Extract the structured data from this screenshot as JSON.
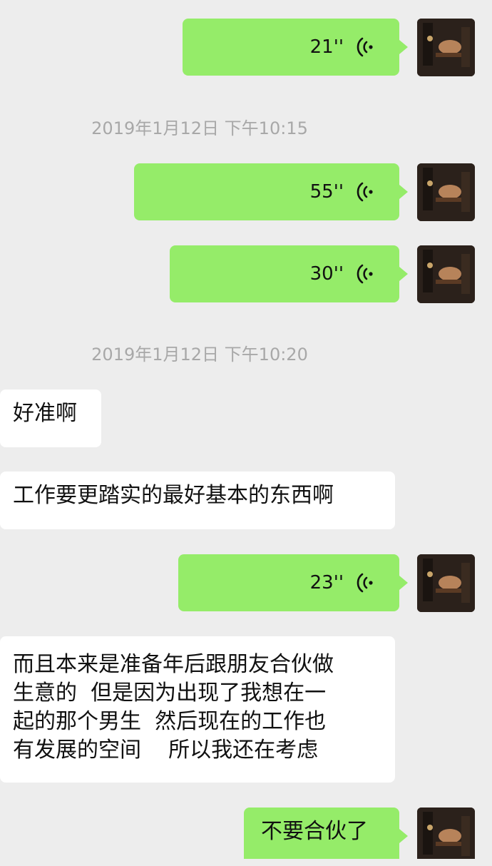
{
  "messages": [
    {
      "type": "voice",
      "side": "right",
      "duration": "21''"
    },
    {
      "type": "timestamp",
      "text": "2019年1月12日 下午10:15"
    },
    {
      "type": "voice",
      "side": "right",
      "duration": "55''"
    },
    {
      "type": "voice",
      "side": "right",
      "duration": "30''"
    },
    {
      "type": "timestamp",
      "text": "2019年1月12日 下午10:20"
    },
    {
      "type": "text",
      "side": "left",
      "text": "好准啊"
    },
    {
      "type": "text",
      "side": "left",
      "text": "工作要更踏实的最好基本的东西啊"
    },
    {
      "type": "voice",
      "side": "right",
      "duration": "23''"
    },
    {
      "type": "text",
      "side": "left",
      "text": "而且本来是准备年后跟朋友合伙做\n生意的  但是因为出现了我想在一\n起的那个男生  然后现在的工作也\n有发展的空间    所以我还在考虑"
    },
    {
      "type": "text",
      "side": "right",
      "text": "不要合伙了"
    }
  ],
  "colors": {
    "background": "#ededed",
    "sent_bubble": "#95ec69",
    "received_bubble": "#ffffff",
    "timestamp_text": "#a8a8a8"
  },
  "icons": {
    "voice": "voice-wave-icon",
    "avatar": "user-avatar"
  }
}
